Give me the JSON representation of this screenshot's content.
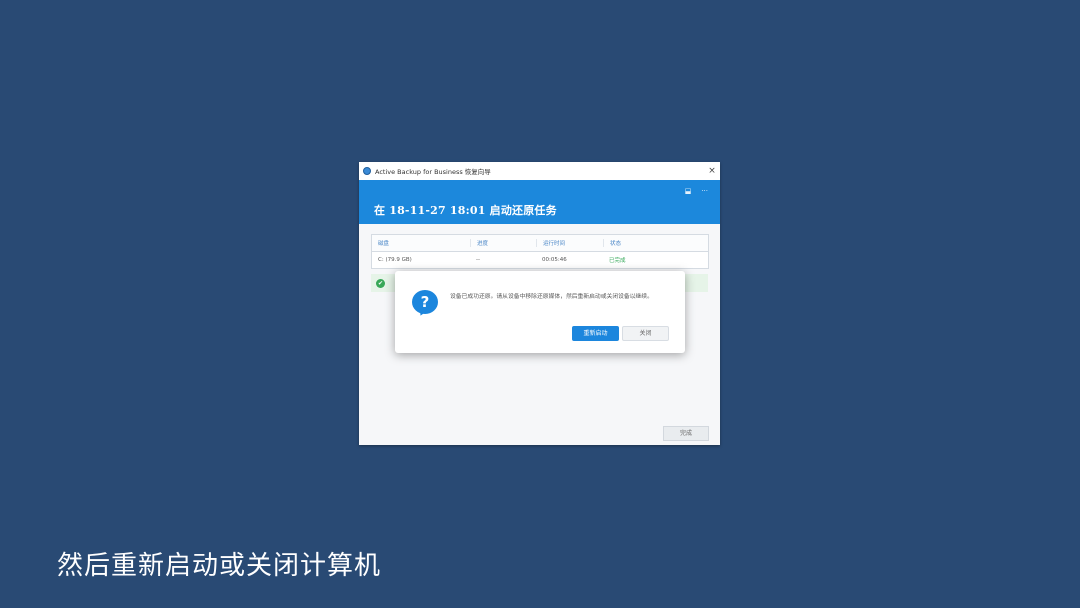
{
  "window": {
    "title": "Active Backup for Business 恢复向导",
    "close_glyph": "×",
    "banner_title": "在 18-11-27 18:01 启动还原任务",
    "banner_icon_a": "⬓",
    "banner_icon_b": "···"
  },
  "table": {
    "headers": [
      "磁盘",
      "进度",
      "运行时间",
      "状态"
    ],
    "rows": [
      {
        "disk": "C: (79.9 GB)",
        "progress": "--",
        "runtime": "00:05:46",
        "status": "已完成"
      }
    ]
  },
  "success_bar": {
    "glyph": "✔",
    "text": ""
  },
  "footer": {
    "done_label": "完成"
  },
  "dialog": {
    "icon_glyph": "?",
    "message": "设备已成功还原。请从设备中移除还原媒体，然后重新启动或关闭设备以继续。",
    "primary_label": "重新启动",
    "secondary_label": "关闭"
  },
  "caption": "然后重新启动或关闭计算机",
  "colors": {
    "background": "#294a74",
    "banner": "#1c88dc",
    "accent": "#1c86dd",
    "success": "#36a95a"
  },
  "icons": [
    "app-logo-icon",
    "close-icon",
    "feedback-icon",
    "more-icon",
    "check-circle-icon",
    "question-icon"
  ]
}
